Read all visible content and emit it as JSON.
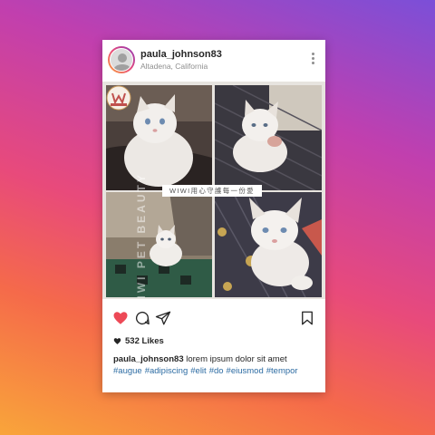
{
  "post": {
    "username": "paula_johnson83",
    "location": "Altadena, California",
    "banner_text": "WIWI用心守護每一份愛",
    "watermark": "WIWI PET BEAUTY",
    "likes": "532 Likes",
    "caption_text": "lorem ipsum dolor sit amet",
    "hashtags": [
      "#augue",
      "#adipiscing",
      "#elit",
      "#do",
      "#eiusmod",
      "#tempor"
    ]
  },
  "icons": {
    "more": "more-options-icon",
    "like": "heart-icon",
    "comment": "comment-icon",
    "share": "send-icon",
    "save": "bookmark-icon",
    "likes": "small-heart-icon"
  },
  "colors": {
    "like_red": "#ed4956",
    "hashtag_blue": "#2d6ca3",
    "text": "#262626",
    "muted": "#8e8e8e"
  }
}
